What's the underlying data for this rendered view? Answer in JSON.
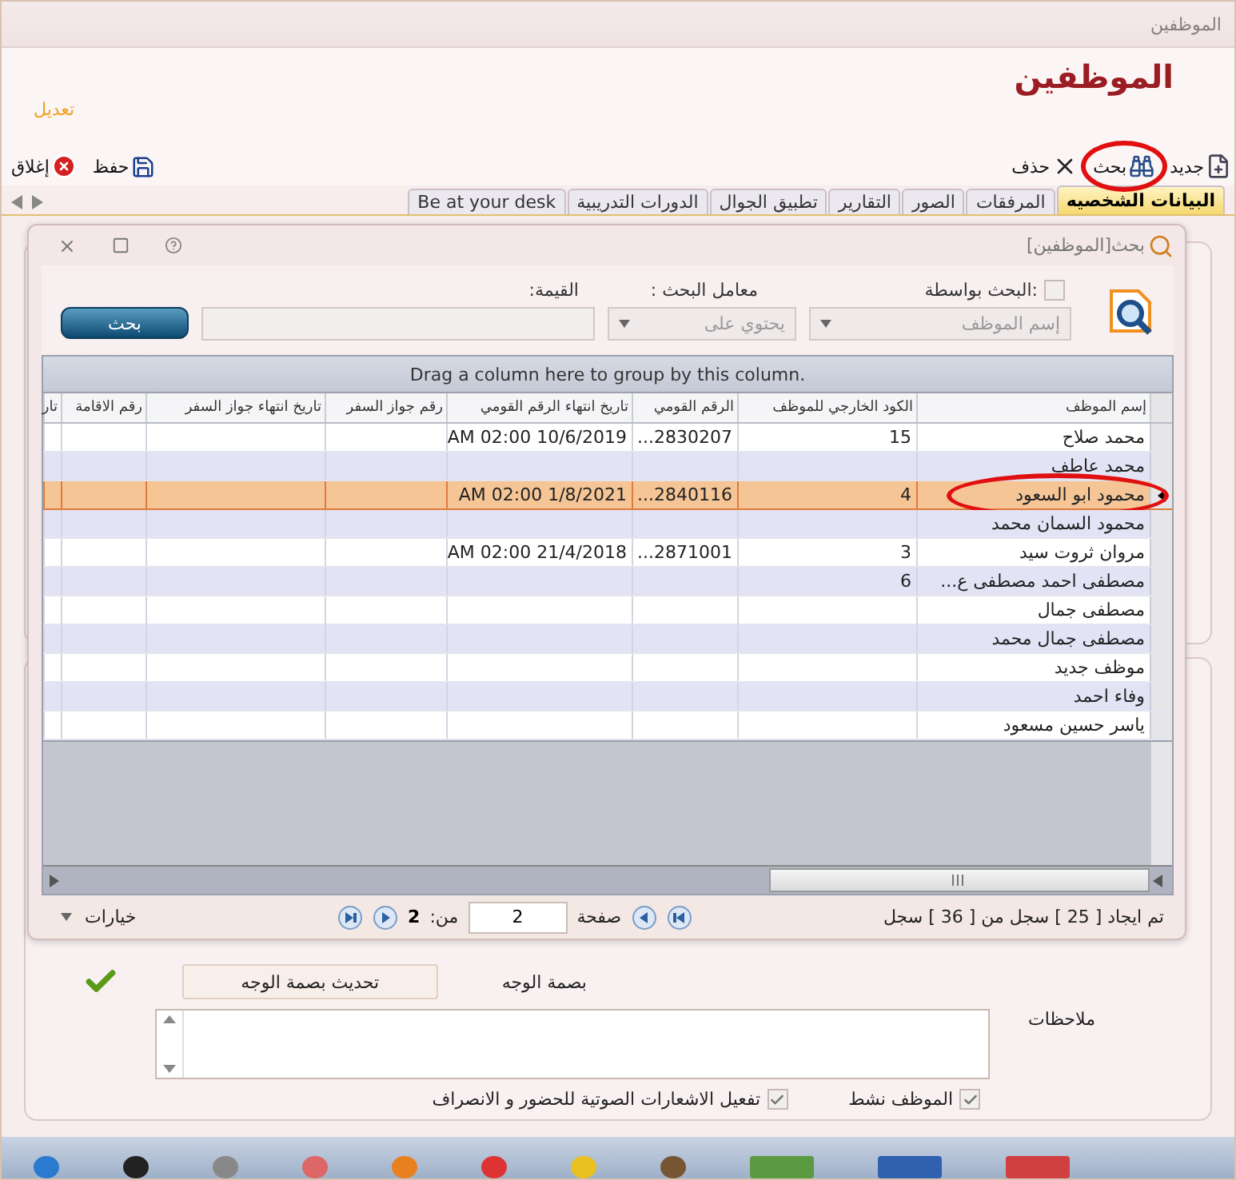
{
  "window": {
    "title": "الموظفين"
  },
  "header": {
    "title": "الموظفين",
    "mode": "تعديل"
  },
  "toolbar": {
    "actions": [
      {
        "kind": "new",
        "label": "جديد",
        "circled": false
      },
      {
        "kind": "search",
        "label": "بحث",
        "circled": true
      },
      {
        "kind": "delete",
        "label": "حذف",
        "circled": false
      }
    ],
    "end_actions": [
      {
        "kind": "save",
        "label": "حفظ"
      },
      {
        "kind": "close",
        "label": "إغلاق"
      }
    ]
  },
  "tabs": [
    {
      "label": "البيانات الشخصيه",
      "selected": true
    },
    {
      "label": "المرفقات",
      "selected": false
    },
    {
      "label": "الصور",
      "selected": false
    },
    {
      "label": "التقارير",
      "selected": false
    },
    {
      "label": "تطبيق الجوال",
      "selected": false
    },
    {
      "label": "الدورات التدريبية",
      "selected": false
    },
    {
      "label": "Be at your desk",
      "selected": false
    }
  ],
  "dialog": {
    "title": "بحث[الموظفين]",
    "search_by": {
      "label": ":البحث بواسطة",
      "checked": false,
      "value": "إسم الموظف"
    },
    "operator": {
      "label": "معامل البحث :",
      "value": "يحتوي على"
    },
    "value_field": {
      "label": "القيمة:"
    },
    "button": "بحث",
    "grid": {
      "group_hint": "Drag a column here to group by this column.",
      "columns": [
        "إسم الموظف",
        "الكود الخارجي للموظف",
        "الرقم القومي",
        "تاريخ انتهاء الرقم القومي",
        "رقم جواز السفر",
        "تاريخ انتهاء جواز السفر",
        "رقم الاقامة",
        "تار"
      ],
      "rows": [
        {
          "name": "محمد صلاح",
          "code": "15",
          "national_id": "...2830207",
          "national_id_expiry": "AM 02:00 10/6/2019",
          "selected": false,
          "circled": false
        },
        {
          "name": "محمد عاطف",
          "selected": false,
          "circled": false
        },
        {
          "name": "محمود ابو السعود",
          "code": "4",
          "national_id": "...2840116",
          "national_id_expiry": "AM 02:00 1/8/2021",
          "selected": true,
          "circled": true
        },
        {
          "name": "محمود السمان محمد",
          "selected": false,
          "circled": false
        },
        {
          "name": "مروان ثروت سيد",
          "code": "3",
          "national_id": "...2871001",
          "national_id_expiry": "AM 02:00 21/4/2018",
          "selected": false,
          "circled": false
        },
        {
          "name": "مصطفى احمد مصطفى ع...",
          "code": "6",
          "selected": false,
          "circled": false
        },
        {
          "name": "مصطفى جمال",
          "selected": false,
          "circled": false
        },
        {
          "name": "مصطفى جمال محمد",
          "selected": false,
          "circled": false
        },
        {
          "name": "موظف جديد",
          "selected": false,
          "circled": false
        },
        {
          "name": "وفاء احمد",
          "selected": false,
          "circled": false
        },
        {
          "name": "ياسر حسين مسعود",
          "selected": false,
          "circled": false
        }
      ]
    },
    "pager": {
      "status": "تم ايجاد [ 25 ] سجل من [ 36 ] سجل",
      "page_label": "صفحة",
      "page_value": "2",
      "of_label": "من:",
      "total": "2",
      "options": "خيارات"
    }
  },
  "form": {
    "face_label": "بصمة الوجه",
    "face_button": "تحديث بصمة الوجه",
    "face_ok": true,
    "notes_label": "ملاحظات",
    "checkboxes": [
      {
        "label": "الموظف نشط",
        "checked": true
      },
      {
        "label": "تفعيل الاشعارات الصوتية للحضور و الانصراف",
        "checked": true
      }
    ]
  }
}
